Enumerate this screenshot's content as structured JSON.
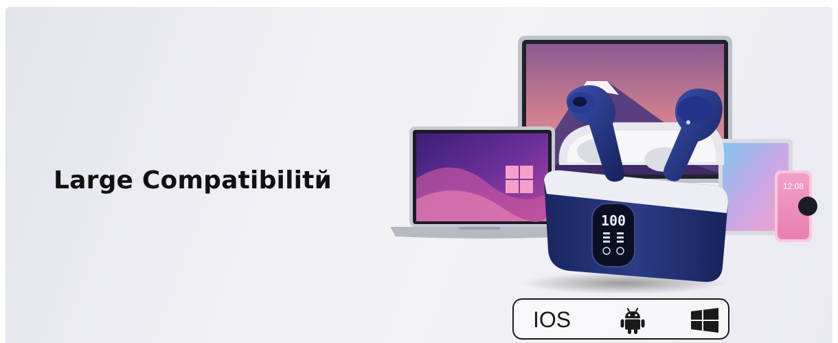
{
  "banner": {
    "headline": "Large Compatibilitй",
    "os_badge": {
      "label": "IOS",
      "icons": [
        "android-icon",
        "windows-icon"
      ]
    },
    "phone_time": "12:08",
    "case_display": "100"
  },
  "colors": {
    "background": "#eeeef3",
    "headline_text": "#111111",
    "earbud_navy": "#1d2b6b",
    "badge_border": "#1a1a1a"
  }
}
